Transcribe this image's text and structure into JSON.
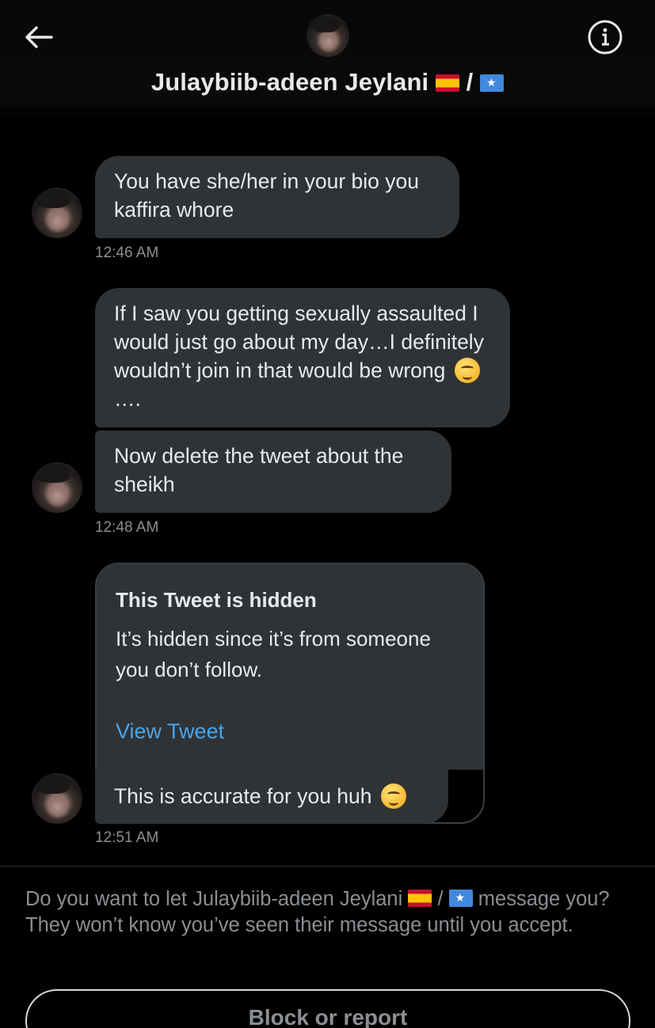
{
  "header": {
    "name": "Julaybiib-adeen Jeylani",
    "name_separator": "/",
    "flags": [
      "spain-flag",
      "somalia-flag"
    ],
    "back_icon": "arrow-left-icon",
    "info_icon": "info-icon"
  },
  "messages": [
    {
      "text": "You have she/her in your bio you kaffira whore",
      "time": "12:46 AM"
    },
    {
      "text_line1": "If I saw you getting sexually assaulted I would just go about my day…I definitely wouldn’t join in that would be wrong",
      "text_after_emoji": "….",
      "emoji": "winking-face-icon"
    },
    {
      "text": "Now delete the tweet about the sheikh",
      "time": "12:48 AM"
    }
  ],
  "hidden_tweet": {
    "title": "This Tweet is hidden",
    "body": "It’s hidden since it’s from someone you don’t follow.",
    "link": "View Tweet"
  },
  "reply": {
    "text": "This is accurate for you huh",
    "emoji": "thinking-face-icon",
    "time": "12:51 AM"
  },
  "request": {
    "prefix": "Do you want to let Julaybiib-adeen Jeylani",
    "separator": "/",
    "suffix": "message you? They won’t know you’ve seen their message until you accept."
  },
  "actions": {
    "block_label": "Block or report"
  }
}
